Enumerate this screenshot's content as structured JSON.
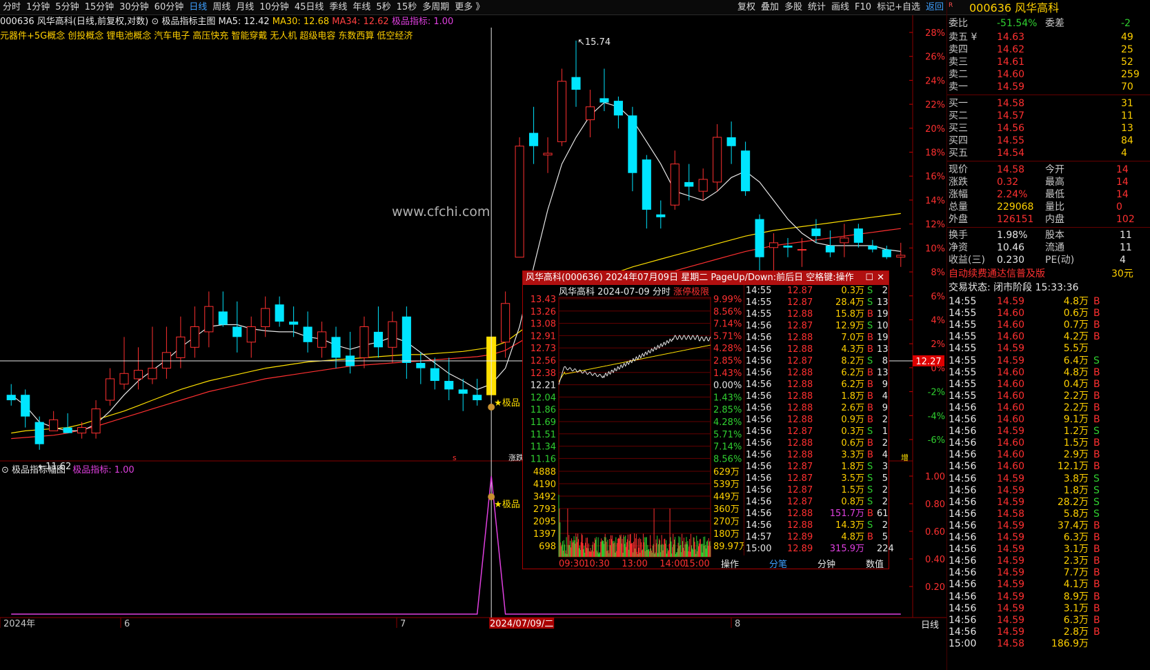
{
  "colors": {
    "up": "#ff3030",
    "down": "#00e5ff",
    "ma5": "#e8e8e8",
    "ma30": "#ffe000",
    "ma34": "#ff3030",
    "indicator": "#e040e0",
    "bg": "#000000"
  },
  "toolbar": {
    "tabs": [
      "分时",
      "1分钟",
      "5分钟",
      "15分钟",
      "30分钟",
      "60分钟",
      "日线",
      "周线",
      "月线",
      "10分钟",
      "45日线",
      "季线",
      "年线",
      "5秒",
      "15秒",
      "多周期",
      "更多 》"
    ],
    "active_tab": "日线",
    "right_buttons": [
      "复权",
      "叠加",
      "多股",
      "统计",
      "画线",
      "F10",
      "标记+自选",
      "返回"
    ]
  },
  "stock": {
    "code": "000636",
    "name": "风华高科",
    "title": "000636 风华高科"
  },
  "infobar": {
    "label": "000636 风华高科(日线,前复权,对数)",
    "main_indicator": "极品指标主图",
    "ma5": "MA5: 12.42",
    "ma30": "MA30: 12.68",
    "ma34": "MA34: 12.62",
    "jp": "极品指标: 1.00"
  },
  "concepts": [
    "元器件+5G概念",
    "创投概念",
    "锂电池概念",
    "汽车电子",
    "高压快充",
    "智能穿戴",
    "无人机",
    "超级电容",
    "东数西算",
    "低空经济"
  ],
  "watermark": "www.cfchi.com",
  "annotations": {
    "high": "15.74",
    "low": "←11.62",
    "star": "★极品",
    "star2": "★极品",
    "crosshair_price": "12.27",
    "crosshair_date": "2024/07/09/二",
    "small_label": "涨跌",
    "zeng": "增"
  },
  "x_axis": [
    "2024年",
    "6",
    "7",
    "8"
  ],
  "price_axis_pct": [
    "28%",
    "26%",
    "24%",
    "22%",
    "20%",
    "18%",
    "16%",
    "14%",
    "12%",
    "10%",
    "8%",
    "6%",
    "4%",
    "2%",
    "0%",
    "-2%",
    "-4%",
    "-6%"
  ],
  "sub_panel": {
    "title": "极品指标幅图",
    "value": "极品指标: 1.00",
    "axis": [
      "1.00",
      "0.80",
      "0.60",
      "0.40",
      "0.20"
    ]
  },
  "bottom_right": "日线",
  "chart_data": {
    "type": "candlestick",
    "title": "000636 风华高科(日线,前复权,对数)",
    "candles": [
      {
        "o": 11.95,
        "h": 12.05,
        "l": 11.85,
        "c": 11.9
      },
      {
        "o": 11.95,
        "h": 12.0,
        "l": 11.65,
        "c": 11.75
      },
      {
        "o": 11.7,
        "h": 11.75,
        "l": 11.45,
        "c": 11.5
      },
      {
        "o": 11.62,
        "h": 11.8,
        "l": 11.62,
        "c": 11.72
      },
      {
        "o": 11.65,
        "h": 11.78,
        "l": 11.6,
        "c": 11.6
      },
      {
        "o": 11.6,
        "h": 11.7,
        "l": 11.55,
        "c": 11.65
      },
      {
        "o": 11.6,
        "h": 11.9,
        "l": 11.55,
        "c": 11.82
      },
      {
        "o": 11.9,
        "h": 12.2,
        "l": 11.85,
        "c": 12.1
      },
      {
        "o": 12.05,
        "h": 12.5,
        "l": 12.0,
        "c": 12.15
      },
      {
        "o": 12.1,
        "h": 12.4,
        "l": 12.0,
        "c": 12.18
      },
      {
        "o": 12.1,
        "h": 12.6,
        "l": 12.05,
        "c": 12.2
      },
      {
        "o": 12.2,
        "h": 12.6,
        "l": 12.1,
        "c": 12.35
      },
      {
        "o": 12.3,
        "h": 12.7,
        "l": 12.2,
        "c": 12.5
      },
      {
        "o": 12.4,
        "h": 12.8,
        "l": 12.3,
        "c": 12.6
      },
      {
        "o": 12.55,
        "h": 12.95,
        "l": 12.4,
        "c": 12.8
      },
      {
        "o": 12.75,
        "h": 12.95,
        "l": 12.6,
        "c": 12.62
      },
      {
        "o": 12.6,
        "h": 12.85,
        "l": 12.35,
        "c": 12.5
      },
      {
        "o": 12.45,
        "h": 12.7,
        "l": 12.3,
        "c": 12.6
      },
      {
        "o": 12.6,
        "h": 12.9,
        "l": 12.5,
        "c": 12.78
      },
      {
        "o": 12.82,
        "h": 12.9,
        "l": 12.6,
        "c": 12.65
      },
      {
        "o": 12.65,
        "h": 12.8,
        "l": 12.5,
        "c": 12.62
      },
      {
        "o": 12.6,
        "h": 12.75,
        "l": 12.35,
        "c": 12.45
      },
      {
        "o": 12.4,
        "h": 12.65,
        "l": 12.3,
        "c": 12.55
      },
      {
        "o": 12.5,
        "h": 12.6,
        "l": 12.2,
        "c": 12.3
      },
      {
        "o": 12.32,
        "h": 12.55,
        "l": 12.15,
        "c": 12.22
      },
      {
        "o": 12.3,
        "h": 12.7,
        "l": 12.2,
        "c": 12.6
      },
      {
        "o": 12.55,
        "h": 12.8,
        "l": 12.3,
        "c": 12.4
      },
      {
        "o": 12.4,
        "h": 12.75,
        "l": 12.25,
        "c": 12.65
      },
      {
        "o": 12.7,
        "h": 12.8,
        "l": 12.1,
        "c": 12.25
      },
      {
        "o": 12.25,
        "h": 12.35,
        "l": 12.05,
        "c": 12.2
      },
      {
        "o": 12.2,
        "h": 12.3,
        "l": 12.0,
        "c": 12.08
      },
      {
        "o": 12.08,
        "h": 12.3,
        "l": 11.9,
        "c": 12.0
      },
      {
        "o": 12.0,
        "h": 12.1,
        "l": 11.8,
        "c": 11.96
      },
      {
        "o": 11.95,
        "h": 12.1,
        "l": 11.85,
        "c": 11.9
      },
      {
        "o": 11.95,
        "h": 12.5,
        "l": 11.9,
        "c": 12.5
      },
      {
        "o": 12.45,
        "h": 12.95,
        "l": 12.3,
        "c": 12.83
      },
      {
        "o": 13.3,
        "h": 14.6,
        "l": 13.3,
        "c": 14.5
      },
      {
        "o": 14.65,
        "h": 14.95,
        "l": 14.3,
        "c": 14.5
      },
      {
        "o": 14.4,
        "h": 14.6,
        "l": 14.2,
        "c": 14.42
      },
      {
        "o": 14.55,
        "h": 15.4,
        "l": 14.5,
        "c": 15.25
      },
      {
        "o": 15.3,
        "h": 15.74,
        "l": 14.95,
        "c": 15.15
      },
      {
        "o": 14.8,
        "h": 15.15,
        "l": 14.6,
        "c": 14.95
      },
      {
        "o": 15.05,
        "h": 15.4,
        "l": 14.9,
        "c": 15.0
      },
      {
        "o": 15.02,
        "h": 15.07,
        "l": 14.7,
        "c": 14.85
      },
      {
        "o": 14.85,
        "h": 14.95,
        "l": 14.0,
        "c": 14.2
      },
      {
        "o": 14.35,
        "h": 14.4,
        "l": 13.6,
        "c": 13.8
      },
      {
        "o": 13.75,
        "h": 13.9,
        "l": 13.6,
        "c": 13.72
      },
      {
        "o": 13.85,
        "h": 14.45,
        "l": 13.8,
        "c": 14.3
      },
      {
        "o": 14.1,
        "h": 14.3,
        "l": 13.9,
        "c": 14.05
      },
      {
        "o": 14.0,
        "h": 14.25,
        "l": 13.9,
        "c": 14.13
      },
      {
        "o": 14.1,
        "h": 14.75,
        "l": 14.0,
        "c": 14.6
      },
      {
        "o": 14.6,
        "h": 14.78,
        "l": 14.3,
        "c": 14.5
      },
      {
        "o": 14.45,
        "h": 14.55,
        "l": 13.95,
        "c": 14.0
      },
      {
        "o": 13.7,
        "h": 13.75,
        "l": 13.1,
        "c": 13.3
      },
      {
        "o": 13.4,
        "h": 13.55,
        "l": 13.15,
        "c": 13.45
      },
      {
        "o": 13.42,
        "h": 13.5,
        "l": 13.3,
        "c": 13.4
      },
      {
        "o": 13.38,
        "h": 13.5,
        "l": 13.2,
        "c": 13.38
      },
      {
        "o": 13.6,
        "h": 13.7,
        "l": 13.45,
        "c": 13.52
      },
      {
        "o": 13.42,
        "h": 13.58,
        "l": 13.3,
        "c": 13.35
      },
      {
        "o": 13.45,
        "h": 13.65,
        "l": 13.3,
        "c": 13.5
      },
      {
        "o": 13.6,
        "h": 13.65,
        "l": 13.4,
        "c": 13.45
      },
      {
        "o": 13.42,
        "h": 13.48,
        "l": 13.35,
        "c": 13.38
      },
      {
        "o": 13.38,
        "h": 13.42,
        "l": 13.28,
        "c": 13.3
      },
      {
        "o": 13.3,
        "h": 13.45,
        "l": 13.2,
        "c": 13.32
      }
    ],
    "ma5": [
      11.95,
      11.85,
      11.7,
      11.65,
      11.62,
      11.62,
      11.68,
      11.8,
      11.95,
      12.08,
      12.18,
      12.28,
      12.4,
      12.5,
      12.6,
      12.62,
      12.62,
      12.58,
      12.56,
      12.55,
      12.55,
      12.5,
      12.48,
      12.42,
      12.38,
      12.42,
      12.45,
      12.5,
      12.45,
      12.35,
      12.25,
      12.15,
      12.08,
      12.0,
      12.05,
      12.2,
      12.6,
      13.2,
      13.8,
      14.3,
      14.6,
      14.85,
      15.0,
      14.95,
      14.8,
      14.55,
      14.3,
      14.0,
      13.95,
      13.9,
      14.0,
      14.15,
      14.22,
      14.1,
      13.9,
      13.7,
      13.55,
      13.45,
      13.42,
      13.42,
      13.42,
      13.42,
      13.38,
      13.36
    ],
    "ma30": [
      11.6,
      11.62,
      11.63,
      11.64,
      11.65,
      11.68,
      11.72,
      11.76,
      11.8,
      11.85,
      11.9,
      11.95,
      12.0,
      12.04,
      12.08,
      12.11,
      12.14,
      12.17,
      12.2,
      12.22,
      12.24,
      12.26,
      12.27,
      12.28,
      12.29,
      12.3,
      12.31,
      12.32,
      12.33,
      12.33,
      12.34,
      12.35,
      12.36,
      12.38,
      12.4,
      12.45,
      12.55,
      12.65,
      12.75,
      12.85,
      12.95,
      13.03,
      13.1,
      13.15,
      13.2,
      13.24,
      13.28,
      13.32,
      13.36,
      13.4,
      13.44,
      13.48,
      13.52,
      13.55,
      13.58,
      13.6,
      13.62,
      13.64,
      13.66,
      13.68,
      13.7,
      13.72,
      13.74,
      13.76
    ],
    "ma34": [
      11.55,
      11.56,
      11.57,
      11.58,
      11.6,
      11.63,
      11.66,
      11.7,
      11.74,
      11.78,
      11.82,
      11.86,
      11.9,
      11.94,
      11.98,
      12.01,
      12.04,
      12.07,
      12.1,
      12.12,
      12.14,
      12.16,
      12.18,
      12.2,
      12.22,
      12.23,
      12.24,
      12.25,
      12.26,
      12.27,
      12.28,
      12.29,
      12.3,
      12.31,
      12.33,
      12.37,
      12.45,
      12.53,
      12.6,
      12.68,
      12.76,
      12.83,
      12.9,
      12.96,
      13.02,
      13.07,
      13.12,
      13.16,
      13.2,
      13.24,
      13.28,
      13.32,
      13.36,
      13.39,
      13.42,
      13.44,
      13.46,
      13.48,
      13.5,
      13.52,
      13.54,
      13.56,
      13.58,
      13.6
    ],
    "indicator": [
      0,
      0,
      0,
      0,
      0,
      0,
      0,
      0,
      0,
      0,
      0,
      0,
      0,
      0,
      0,
      0,
      0,
      0,
      0,
      0,
      0,
      0,
      0,
      0,
      0,
      0,
      0,
      0,
      0,
      0,
      0,
      0,
      0,
      0,
      1,
      0,
      0,
      0,
      0,
      0,
      0,
      0,
      0,
      0,
      0,
      0,
      0,
      0,
      0,
      0,
      0,
      0,
      0,
      0,
      0,
      0,
      0,
      0,
      0,
      0,
      0,
      0,
      0,
      0
    ],
    "signal_index": 34,
    "ylim": [
      11.4,
      15.9
    ],
    "ref_price": 12.27
  },
  "popup": {
    "title": "风华高科(000636) 2024年07月09日 星期二 PageUp/Down:前后日 空格键:操作",
    "subtitle": "风华高科  2024-07-09 分时",
    "limit_label": "涨停极限",
    "price_axis": [
      "13.43",
      "13.26",
      "13.08",
      "12.91",
      "12.73",
      "12.56",
      "12.38",
      "12.21",
      "12.04",
      "11.86",
      "11.69",
      "11.51",
      "11.34",
      "11.16"
    ],
    "pct_axis": [
      "9.99%",
      "8.56%",
      "7.14%",
      "5.71%",
      "4.28%",
      "2.85%",
      "1.43%",
      "0.00%",
      "1.43%",
      "2.85%",
      "4.28%",
      "5.71%",
      "7.14%",
      "8.56%"
    ],
    "vol_axis_left": [
      "4888",
      "4190",
      "3492",
      "2793",
      "2095",
      "1397",
      "698"
    ],
    "vol_axis_right": [
      "629万",
      "539万",
      "449万",
      "360万",
      "270万",
      "180万",
      "89.97万"
    ],
    "time_axis": [
      "09:30",
      "10:30",
      "13:00",
      "14:00",
      "15:00"
    ],
    "bottom_tabs": [
      "操作",
      "分笔",
      "分钟",
      "数值"
    ],
    "ticks": [
      {
        "t": "14:55",
        "p": "12.87",
        "v": "0.3万",
        "bs": "S",
        "n": "2"
      },
      {
        "t": "14:55",
        "p": "12.87",
        "v": "28.4万",
        "bs": "S",
        "n": "13"
      },
      {
        "t": "14:55",
        "p": "12.88",
        "v": "15.8万",
        "bs": "B",
        "n": "19"
      },
      {
        "t": "14:56",
        "p": "12.87",
        "v": "12.9万",
        "bs": "S",
        "n": "10"
      },
      {
        "t": "14:56",
        "p": "12.88",
        "v": "7.0万",
        "bs": "B",
        "n": "19"
      },
      {
        "t": "14:56",
        "p": "12.88",
        "v": "4.3万",
        "bs": "B",
        "n": "13"
      },
      {
        "t": "14:56",
        "p": "12.87",
        "v": "8.2万",
        "bs": "S",
        "n": "8"
      },
      {
        "t": "14:56",
        "p": "12.88",
        "v": "6.2万",
        "bs": "B",
        "n": "13"
      },
      {
        "t": "14:56",
        "p": "12.88",
        "v": "6.2万",
        "bs": "B",
        "n": "9"
      },
      {
        "t": "14:56",
        "p": "12.88",
        "v": "1.8万",
        "bs": "B",
        "n": "4"
      },
      {
        "t": "14:56",
        "p": "12.88",
        "v": "2.6万",
        "bs": "B",
        "n": "9"
      },
      {
        "t": "14:56",
        "p": "12.88",
        "v": "0.9万",
        "bs": "B",
        "n": "2"
      },
      {
        "t": "14:56",
        "p": "12.87",
        "v": "0.3万",
        "bs": "S",
        "n": "1"
      },
      {
        "t": "14:56",
        "p": "12.88",
        "v": "0.6万",
        "bs": "B",
        "n": "2"
      },
      {
        "t": "14:56",
        "p": "12.88",
        "v": "3.3万",
        "bs": "B",
        "n": "4"
      },
      {
        "t": "14:56",
        "p": "12.87",
        "v": "1.8万",
        "bs": "S",
        "n": "3"
      },
      {
        "t": "14:56",
        "p": "12.87",
        "v": "3.5万",
        "bs": "S",
        "n": "5"
      },
      {
        "t": "14:56",
        "p": "12.87",
        "v": "1.5万",
        "bs": "S",
        "n": "2"
      },
      {
        "t": "14:56",
        "p": "12.87",
        "v": "0.8万",
        "bs": "S",
        "n": "2"
      },
      {
        "t": "14:56",
        "p": "12.88",
        "v": "151.7万",
        "bs": "B",
        "n": "61"
      },
      {
        "t": "14:56",
        "p": "12.88",
        "v": "14.3万",
        "bs": "S",
        "n": "2"
      },
      {
        "t": "14:57",
        "p": "12.89",
        "v": "4.8万",
        "bs": "B",
        "n": "5"
      },
      {
        "t": "15:00",
        "p": "12.89",
        "v": "315.9万",
        "bs": "",
        "n": "224"
      }
    ]
  },
  "quote": {
    "weibi": "委比",
    "weibi_v": "-51.54%",
    "weicha": "委差",
    "weicha_v": "-2",
    "asks": [
      {
        "l": "卖五 ¥",
        "p": "14.63",
        "v": "49"
      },
      {
        "l": "卖四",
        "p": "14.62",
        "v": "25"
      },
      {
        "l": "卖三",
        "p": "14.61",
        "v": "52"
      },
      {
        "l": "卖二",
        "p": "14.60",
        "v": "259"
      },
      {
        "l": "卖一",
        "p": "14.59",
        "v": "70"
      }
    ],
    "bids": [
      {
        "l": "买一",
        "p": "14.58",
        "v": "31"
      },
      {
        "l": "买二",
        "p": "14.57",
        "v": "11"
      },
      {
        "l": "买三",
        "p": "14.56",
        "v": "13"
      },
      {
        "l": "买四",
        "p": "14.55",
        "v": "84"
      },
      {
        "l": "买五",
        "p": "14.54",
        "v": "4"
      }
    ],
    "stats": [
      {
        "a": "现价",
        "av": "14.58",
        "b": "今开",
        "bv": "14"
      },
      {
        "a": "涨跌",
        "av": "0.32",
        "b": "最高",
        "bv": "14"
      },
      {
        "a": "涨幅",
        "av": "2.24%",
        "b": "最低",
        "bv": "14"
      },
      {
        "a": "总量",
        "av": "229068",
        "b": "量比",
        "bv": "0"
      },
      {
        "a": "外盘",
        "av": "126151",
        "b": "内盘",
        "bv": "102"
      }
    ],
    "stats2": [
      {
        "a": "换手",
        "av": "1.98%",
        "b": "股本",
        "bv": "11"
      },
      {
        "a": "净资",
        "av": "10.46",
        "b": "流通",
        "bv": "11"
      },
      {
        "a": "收益(三)",
        "av": "0.230",
        "b": "PE(动)",
        "bv": "4"
      }
    ],
    "promo": "自动续费通达信普及版",
    "promo_price": "30元",
    "status": "交易状态: 闭市阶段 15:33:36",
    "trades": [
      {
        "t": "14:55",
        "p": "14.59",
        "v": "4.8万",
        "bs": "B"
      },
      {
        "t": "14:55",
        "p": "14.60",
        "v": "0.6万",
        "bs": "B"
      },
      {
        "t": "14:55",
        "p": "14.60",
        "v": "0.7万",
        "bs": "B"
      },
      {
        "t": "14:55",
        "p": "14.60",
        "v": "4.2万",
        "bs": "B"
      },
      {
        "t": "14:55",
        "p": "14.59",
        "v": "5.5万",
        "bs": ""
      },
      {
        "t": "14:55",
        "p": "14.59",
        "v": "6.4万",
        "bs": "S"
      },
      {
        "t": "14:55",
        "p": "14.60",
        "v": "4.8万",
        "bs": "B"
      },
      {
        "t": "14:55",
        "p": "14.60",
        "v": "0.4万",
        "bs": "B"
      },
      {
        "t": "14:55",
        "p": "14.60",
        "v": "2.2万",
        "bs": "B"
      },
      {
        "t": "14:56",
        "p": "14.60",
        "v": "2.2万",
        "bs": "B"
      },
      {
        "t": "14:56",
        "p": "14.60",
        "v": "9.1万",
        "bs": "B"
      },
      {
        "t": "14:56",
        "p": "14.59",
        "v": "1.2万",
        "bs": "S"
      },
      {
        "t": "14:56",
        "p": "14.60",
        "v": "1.5万",
        "bs": "B"
      },
      {
        "t": "14:56",
        "p": "14.60",
        "v": "2.9万",
        "bs": "B"
      },
      {
        "t": "14:56",
        "p": "14.60",
        "v": "12.1万",
        "bs": "B"
      },
      {
        "t": "14:56",
        "p": "14.59",
        "v": "3.8万",
        "bs": "S"
      },
      {
        "t": "14:56",
        "p": "14.59",
        "v": "1.8万",
        "bs": "S"
      },
      {
        "t": "14:56",
        "p": "14.59",
        "v": "28.2万",
        "bs": "S"
      },
      {
        "t": "14:56",
        "p": "14.58",
        "v": "5.8万",
        "bs": "S"
      },
      {
        "t": "14:56",
        "p": "14.59",
        "v": "37.4万",
        "bs": "B"
      },
      {
        "t": "14:56",
        "p": "14.59",
        "v": "6.3万",
        "bs": "B"
      },
      {
        "t": "14:56",
        "p": "14.59",
        "v": "3.1万",
        "bs": "B"
      },
      {
        "t": "14:56",
        "p": "14.59",
        "v": "2.3万",
        "bs": "B"
      },
      {
        "t": "14:56",
        "p": "14.59",
        "v": "7.7万",
        "bs": "B"
      },
      {
        "t": "14:56",
        "p": "14.59",
        "v": "4.1万",
        "bs": "B"
      },
      {
        "t": "14:56",
        "p": "14.59",
        "v": "8.9万",
        "bs": "B"
      },
      {
        "t": "14:56",
        "p": "14.59",
        "v": "3.1万",
        "bs": "B"
      },
      {
        "t": "14:56",
        "p": "14.59",
        "v": "6.3万",
        "bs": "B"
      },
      {
        "t": "14:56",
        "p": "14.59",
        "v": "2.8万",
        "bs": "B"
      },
      {
        "t": "15:00",
        "p": "14.58",
        "v": "186.9万",
        "bs": ""
      }
    ]
  }
}
